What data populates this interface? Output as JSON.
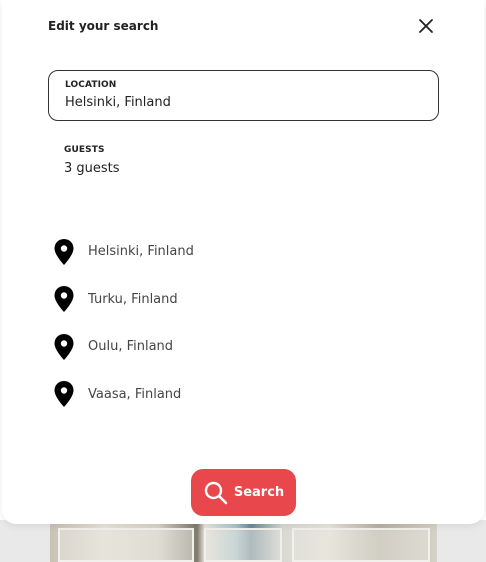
{
  "modal": {
    "title": "Edit your search",
    "close_icon": "close-icon"
  },
  "location": {
    "label": "LOCATION",
    "value": "Helsinki, Finland"
  },
  "guests": {
    "label": "GUESTS",
    "value": "3 guests"
  },
  "suggestions": [
    {
      "label": "Helsinki, Finland",
      "icon": "map-pin-icon"
    },
    {
      "label": "Turku, Finland",
      "icon": "map-pin-icon"
    },
    {
      "label": "Oulu, Finland",
      "icon": "map-pin-icon"
    },
    {
      "label": "Vaasa, Finland",
      "icon": "map-pin-icon"
    }
  ],
  "search_button": {
    "label": "Search",
    "icon": "search-icon",
    "color": "#e8474c"
  }
}
